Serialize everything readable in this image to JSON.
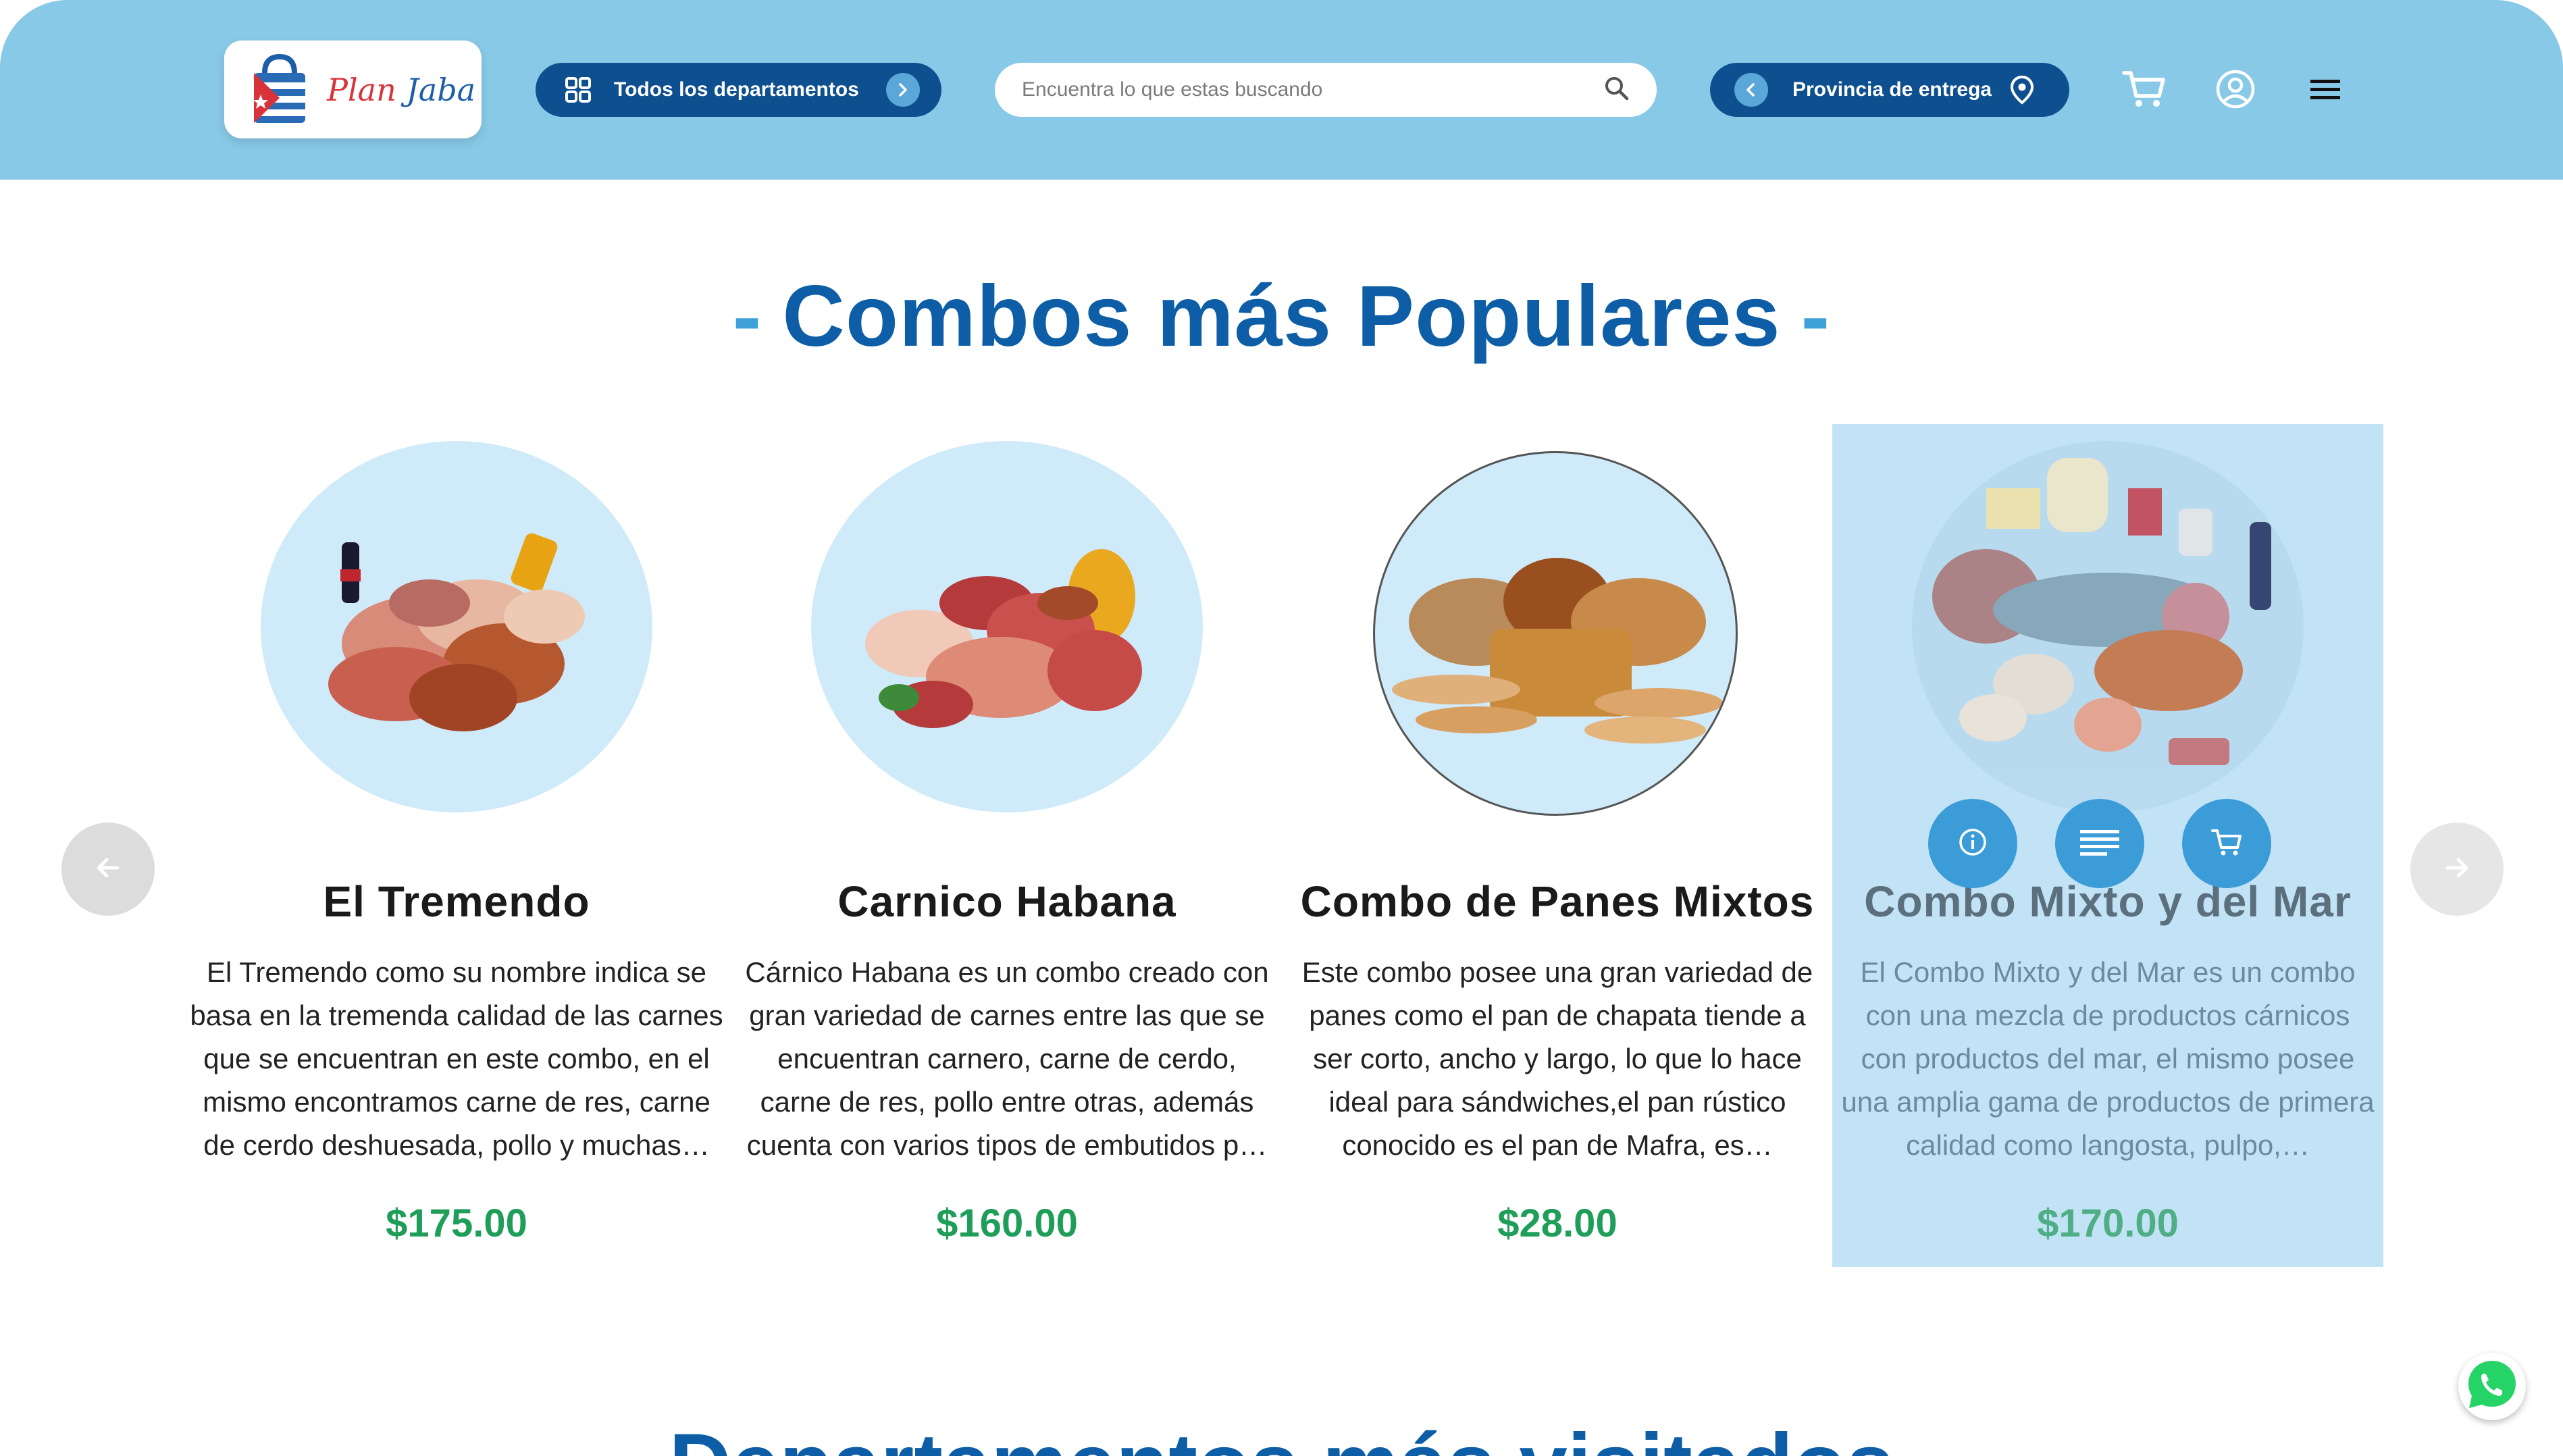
{
  "header": {
    "logo": {
      "brand_part1": "Plan",
      "brand_part2": "Jaba"
    },
    "departments_label": "Todos los departamentos",
    "search": {
      "placeholder": "Encuentra lo que estas buscando",
      "value": ""
    },
    "province_label": "Provincia de entrega",
    "icons": [
      "departments-grid-icon",
      "chevron-right-icon",
      "search-icon",
      "chevron-left-icon",
      "location-pin-icon",
      "cart-icon",
      "user-icon",
      "menu-icon"
    ]
  },
  "popular": {
    "title": "Combos más Populares",
    "dash": "-",
    "cards": [
      {
        "name": "El Tremendo",
        "description": "El Tremendo como su nombre indica se basa en la tremenda calidad de las carnes que se encuentran en este combo, en el mismo encontramos carne de res, carne de cerdo deshuesada, pollo y muchas…",
        "price": "$175.00"
      },
      {
        "name": "Carnico Habana",
        "description": "Cárnico Habana es un combo creado con gran variedad de carnes entre las que se encuentran carnero, carne de cerdo, carne de res, pollo entre otras, además cuenta con varios tipos de embutidos p…",
        "price": "$160.00"
      },
      {
        "name": "Combo de Panes Mixtos",
        "description": "Este combo posee una gran variedad de panes como el pan de chapata tiende a ser corto, ancho y largo, lo que lo hace ideal para sándwiches,el pan rústico conocido es el pan de Mafra, es…",
        "price": "$28.00"
      },
      {
        "name": "Combo Mixto y del Mar",
        "description": "El Combo Mixto y del Mar es un combo con una mezcla de productos cárnicos con productos del mar, el mismo posee una amplia gama de productos de primera calidad como langosta, pulpo,…",
        "price": "$170.00",
        "hover_actions": [
          "info-icon",
          "details-icon",
          "add-to-cart-icon"
        ]
      }
    ]
  },
  "next_section_title": "Departamentos más visitados",
  "colors": {
    "header_bg": "#88c9e7",
    "primary": "#0d4f8f",
    "title": "#0d5ea6",
    "price": "#1e9e58",
    "hover_card": "#c2e2f5"
  }
}
